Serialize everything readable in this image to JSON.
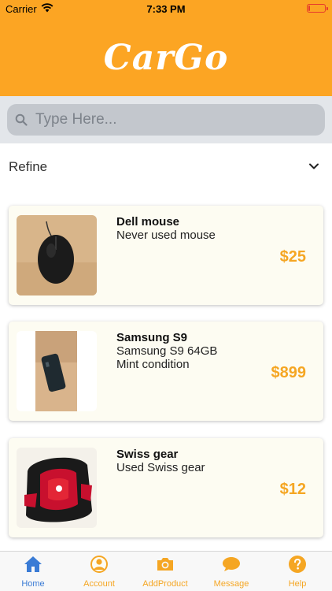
{
  "status_bar": {
    "carrier": "Carrier",
    "time": "7:33 PM",
    "battery_level": 0.08
  },
  "header": {
    "logo": "CarGo"
  },
  "search": {
    "placeholder": "Type Here...",
    "value": ""
  },
  "refine": {
    "label": "Refine"
  },
  "products": [
    {
      "name": "Dell mouse",
      "description": [
        "Never used mouse"
      ],
      "price": "$25"
    },
    {
      "name": "Samsung S9",
      "description": [
        "Samsung S9 64GB",
        "Mint condition"
      ],
      "price": "$899"
    },
    {
      "name": "Swiss gear",
      "description": [
        "Used Swiss gear"
      ],
      "price": "$12"
    }
  ],
  "tabs": [
    {
      "label": "Home",
      "icon": "home-icon",
      "active": true
    },
    {
      "label": "Account",
      "icon": "account-icon",
      "active": false
    },
    {
      "label": "AddProduct",
      "icon": "camera-icon",
      "active": false
    },
    {
      "label": "Message",
      "icon": "chat-icon",
      "active": false
    },
    {
      "label": "Help",
      "icon": "help-icon",
      "active": false
    }
  ],
  "colors": {
    "brand": "#fca523",
    "accent_price": "#f5a623",
    "tab_active": "#3a7bd5",
    "battery_low": "#e6392c"
  }
}
